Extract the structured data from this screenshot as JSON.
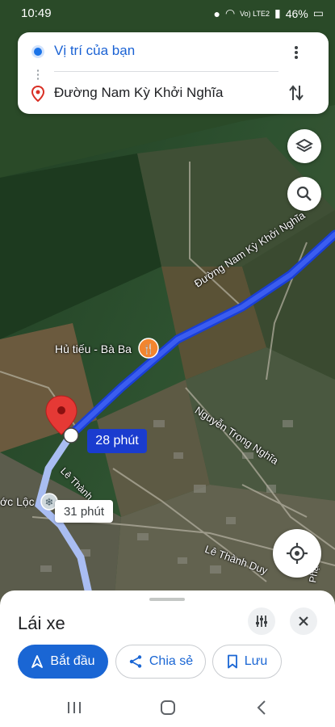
{
  "status_bar": {
    "time": "10:49",
    "network": "Vo) LTE2",
    "battery": "46%"
  },
  "route": {
    "origin": "Vị trí của bạn",
    "destination": "Đường Nam Kỳ Khởi Nghĩa"
  },
  "map": {
    "labels": {
      "road_main": "Đường Nam Kỳ Khởi Nghĩa",
      "poi": "Hủ tiếu - Bà Ba",
      "road_nguyen": "Nguyễn Trọng Nghĩa",
      "road_le_thanh": "Lê Thành",
      "road_le_thanh_duy": "Lê Thành Duy",
      "place_left": "ớc Lộc",
      "road_edge_right": "Phạ"
    },
    "time_main": "28 phút",
    "time_alt": "31 phút",
    "colors": {
      "route": "#1a46e6",
      "route_alt": "#9fb4f0",
      "pin": "#e53935",
      "poi": "#f2852f"
    }
  },
  "sheet": {
    "mode_title": "Lái xe",
    "buttons": {
      "start": "Bắt đầu",
      "share": "Chia sẻ",
      "save": "Lưu"
    }
  },
  "icons": [
    "more-vert-icon",
    "swap-icon",
    "layers-icon",
    "search-icon",
    "my-location-icon",
    "tune-icon",
    "close-icon",
    "navigation-icon",
    "share-icon",
    "bookmark-icon",
    "recents-icon",
    "home-icon",
    "back-icon"
  ]
}
